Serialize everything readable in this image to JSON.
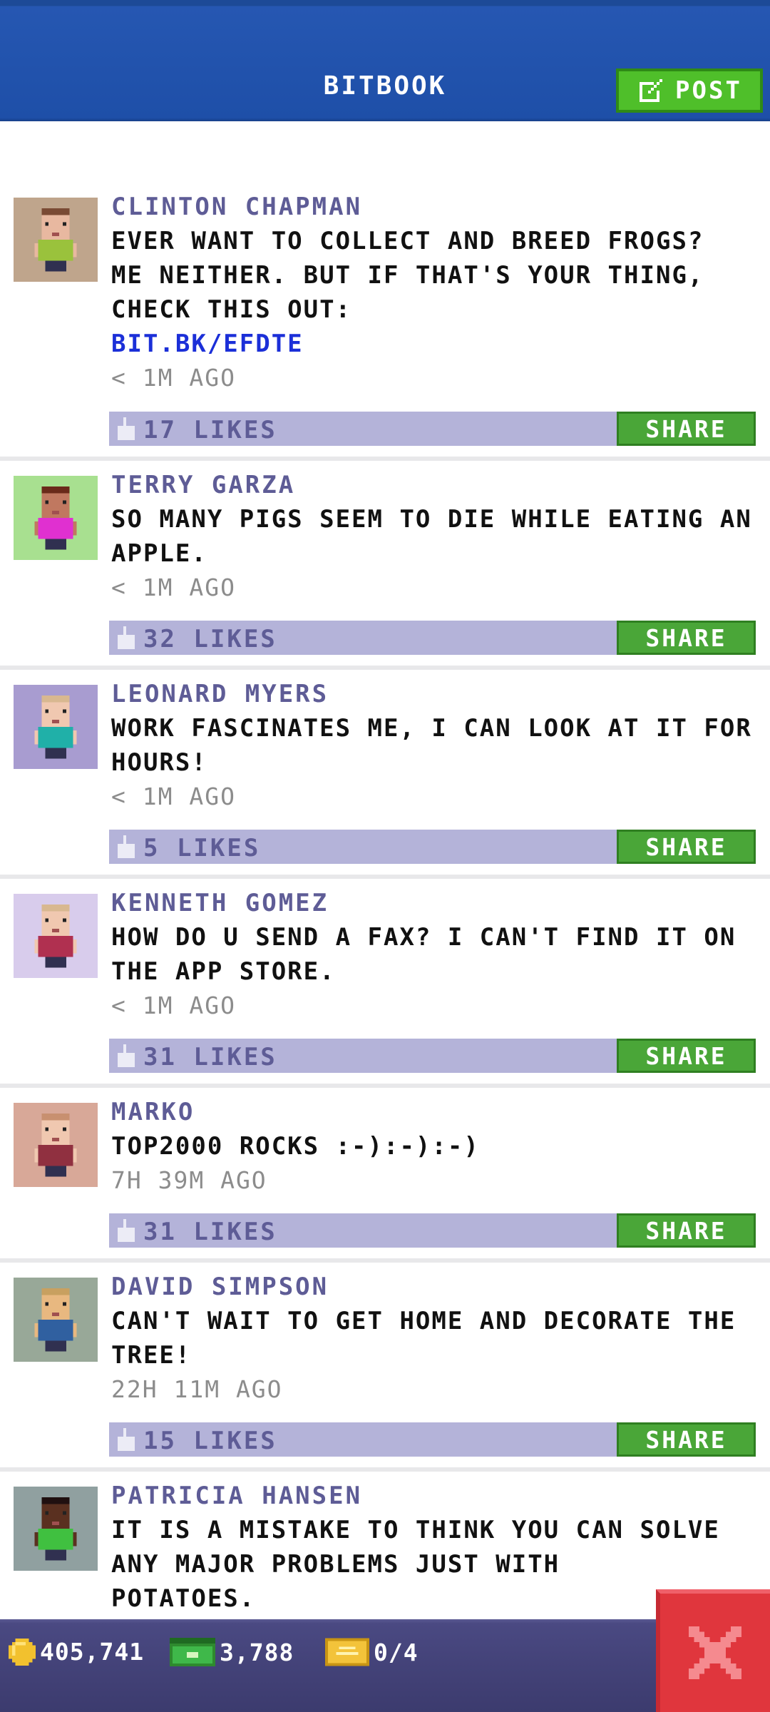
{
  "header": {
    "title": "BITBOOK",
    "post_label": "POST"
  },
  "posts": [
    {
      "author": "CLINTON CHAPMAN",
      "lines": [
        "EVER WANT TO COLLECT AND BREED FROGS?",
        "ME NEITHER. BUT IF THAT'S YOUR THING,",
        "CHECK THIS OUT:"
      ],
      "link": "BIT.BK/EFDTE",
      "time": "< 1M AGO",
      "likes": "17 LIKES",
      "share": "SHARE",
      "avatar_bg": "#bfa58c",
      "skin": "#e8b8a0",
      "shirt": "#9ac23c",
      "hair": "#7a4a34"
    },
    {
      "author": "TERRY GARZA",
      "lines": [
        "SO MANY PIGS SEEM TO DIE WHILE EATING AN",
        "APPLE."
      ],
      "time": "< 1M AGO",
      "likes": "32 LIKES",
      "share": "SHARE",
      "avatar_bg": "#a8e090",
      "skin": "#c07860",
      "shirt": "#e030d0",
      "hair": "#6a2a1a"
    },
    {
      "author": "LEONARD MYERS",
      "lines": [
        "WORK FASCINATES ME, I CAN LOOK AT IT FOR",
        "HOURS!"
      ],
      "time": "< 1M AGO",
      "likes": "5 LIKES",
      "share": "SHARE",
      "avatar_bg": "#a89cd0",
      "skin": "#f0c8b0",
      "shirt": "#20b0a8",
      "hair": "#d8b890"
    },
    {
      "author": "KENNETH GOMEZ",
      "lines": [
        "HOW DO U SEND A FAX? I CAN'T FIND IT ON",
        "THE APP STORE."
      ],
      "time": "< 1M AGO",
      "likes": "31 LIKES",
      "share": "SHARE",
      "avatar_bg": "#d8ccec",
      "skin": "#f0c8b0",
      "shirt": "#b03050",
      "hair": "#d8b890"
    },
    {
      "author": "MARKO",
      "lines": [
        "TOP2000 ROCKS :-):-):-)"
      ],
      "time": "7H 39M AGO",
      "likes": "31 LIKES",
      "share": "SHARE",
      "avatar_bg": "#d8a898",
      "skin": "#f0c8b0",
      "shirt": "#903040",
      "hair": "#c89070"
    },
    {
      "author": "DAVID SIMPSON",
      "lines": [
        "CAN'T WAIT TO GET HOME AND DECORATE THE",
        "TREE!"
      ],
      "time": "22H 11M AGO",
      "likes": "15 LIKES",
      "share": "SHARE",
      "avatar_bg": "#98a898",
      "skin": "#e8b880",
      "shirt": "#3060a0",
      "hair": "#c8a060"
    },
    {
      "author": "PATRICIA HANSEN",
      "lines": [
        "IT IS A MISTAKE TO THINK YOU CAN SOLVE",
        "ANY MAJOR PROBLEMS JUST WITH",
        "POTATOES."
      ],
      "avatar_bg": "#90a0a0",
      "skin": "#5a3020",
      "shirt": "#40c040",
      "hair": "#201010"
    }
  ],
  "status_bar": {
    "coins": "405,741",
    "bux": "3,788",
    "tickets": "0/4"
  },
  "colors": {
    "header": "#1e4fa8",
    "post_button": "#4fbf2a",
    "likes_bar": "#b4b3d9",
    "share": "#4aa638",
    "close": "#e0363d",
    "bottom_bar": "#4a4982"
  },
  "icons": {
    "post": "edit-icon",
    "close": "close-icon",
    "coin": "coin-icon",
    "bux": "bux-icon",
    "ticket": "ticket-icon",
    "like": "thumbs-up-icon"
  }
}
